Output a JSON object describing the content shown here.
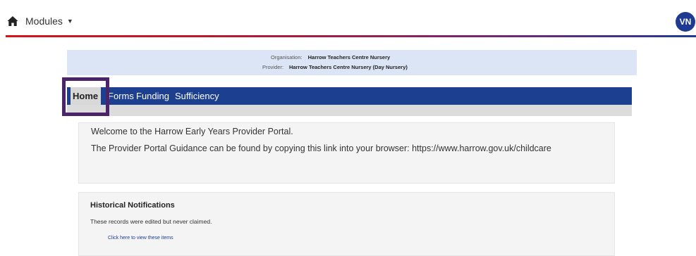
{
  "header": {
    "modules_label": "Modules",
    "avatar_initials": "VN",
    "icons": {
      "home": "home-icon",
      "modules_caret": "caret-down-icon"
    },
    "colors": {
      "brand_blue": "#1d3f8f",
      "brand_red": "#d7141b",
      "focus_outline": "#4b246a"
    }
  },
  "organisation": {
    "org_label": "Organisation:",
    "org_value": "Harrow Teachers Centre Nursery",
    "provider_label": "Provider:",
    "provider_value": "Harrow Teachers Centre Nursery (Day Nursery)"
  },
  "nav": {
    "home": "Home",
    "forms": "Forms",
    "funding": "Funding",
    "sufficiency": "Sufficiency"
  },
  "welcome": {
    "line1": "Welcome to the Harrow Early Years Provider Portal.",
    "line2": "The Provider Portal Guidance can be found by copying this link into your browser: https://www.harrow.gov.uk/childcare"
  },
  "notifications": {
    "title": "Historical Notifications",
    "text": "These records were edited but never claimed.",
    "link": "Click here to view these items"
  }
}
